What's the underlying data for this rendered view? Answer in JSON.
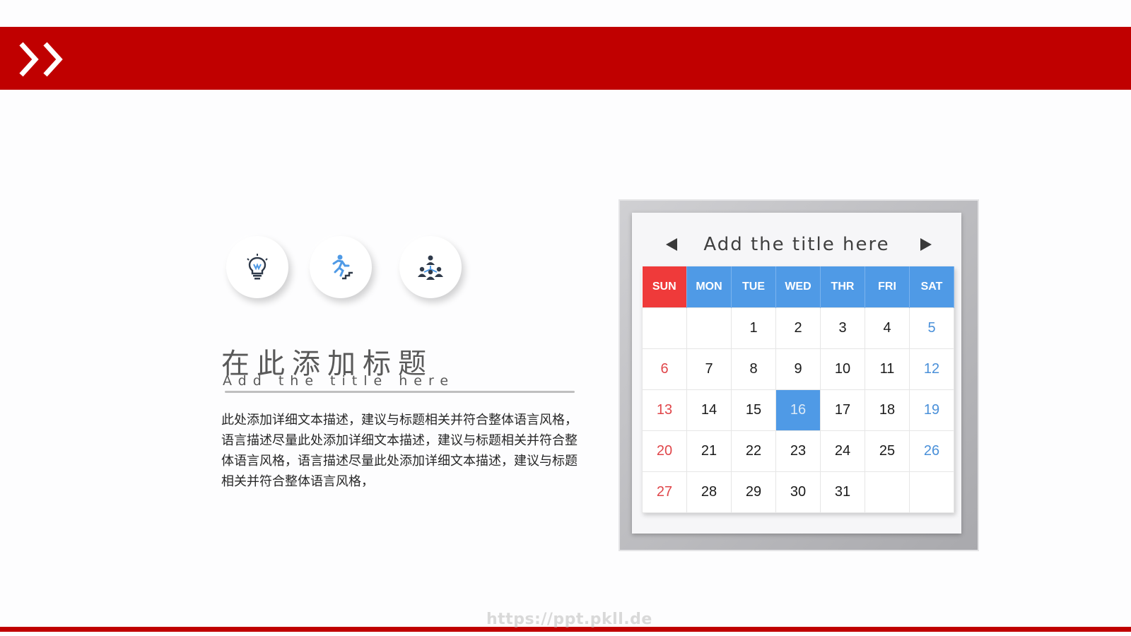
{
  "header": {
    "chevron_icon": "double-chevron-right-icon",
    "bar_color": "#c00000"
  },
  "icons": [
    "lightbulb-icon",
    "climbing-stairs-icon",
    "team-hierarchy-icon"
  ],
  "section": {
    "cn_title": "在此添加标题",
    "en_subtitle": "Add the title here",
    "body": "此处添加详细文本描述，建议与标题相关并符合整体语言风格，语言描述尽量此处添加详细文本描述，建议与标题相关并符合整体语言风格，语言描述尽量此处添加详细文本描述，建议与标题相关并符合整体语言风格，"
  },
  "calendar": {
    "title": "Add  the  title  here",
    "prev_icon": "triangle-left-icon",
    "next_icon": "triangle-right-icon",
    "weekdays": [
      "SUN",
      "MON",
      "TUE",
      "WED",
      "THR",
      "FRI",
      "SAT"
    ],
    "weeks": [
      [
        "",
        "",
        "1",
        "2",
        "3",
        "4",
        "5"
      ],
      [
        "6",
        "7",
        "8",
        "9",
        "10",
        "11",
        "12"
      ],
      [
        "13",
        "14",
        "15",
        "16",
        "17",
        "18",
        "19"
      ],
      [
        "20",
        "21",
        "22",
        "23",
        "24",
        "25",
        "26"
      ],
      [
        "27",
        "28",
        "29",
        "30",
        "31",
        "",
        ""
      ]
    ],
    "highlighted_day": "16",
    "colors": {
      "header": "#4f9ae6",
      "sunday": "#ef3a3a",
      "saturday_text": "#4a90d9"
    }
  },
  "watermark": "https://ppt.pkll.de"
}
